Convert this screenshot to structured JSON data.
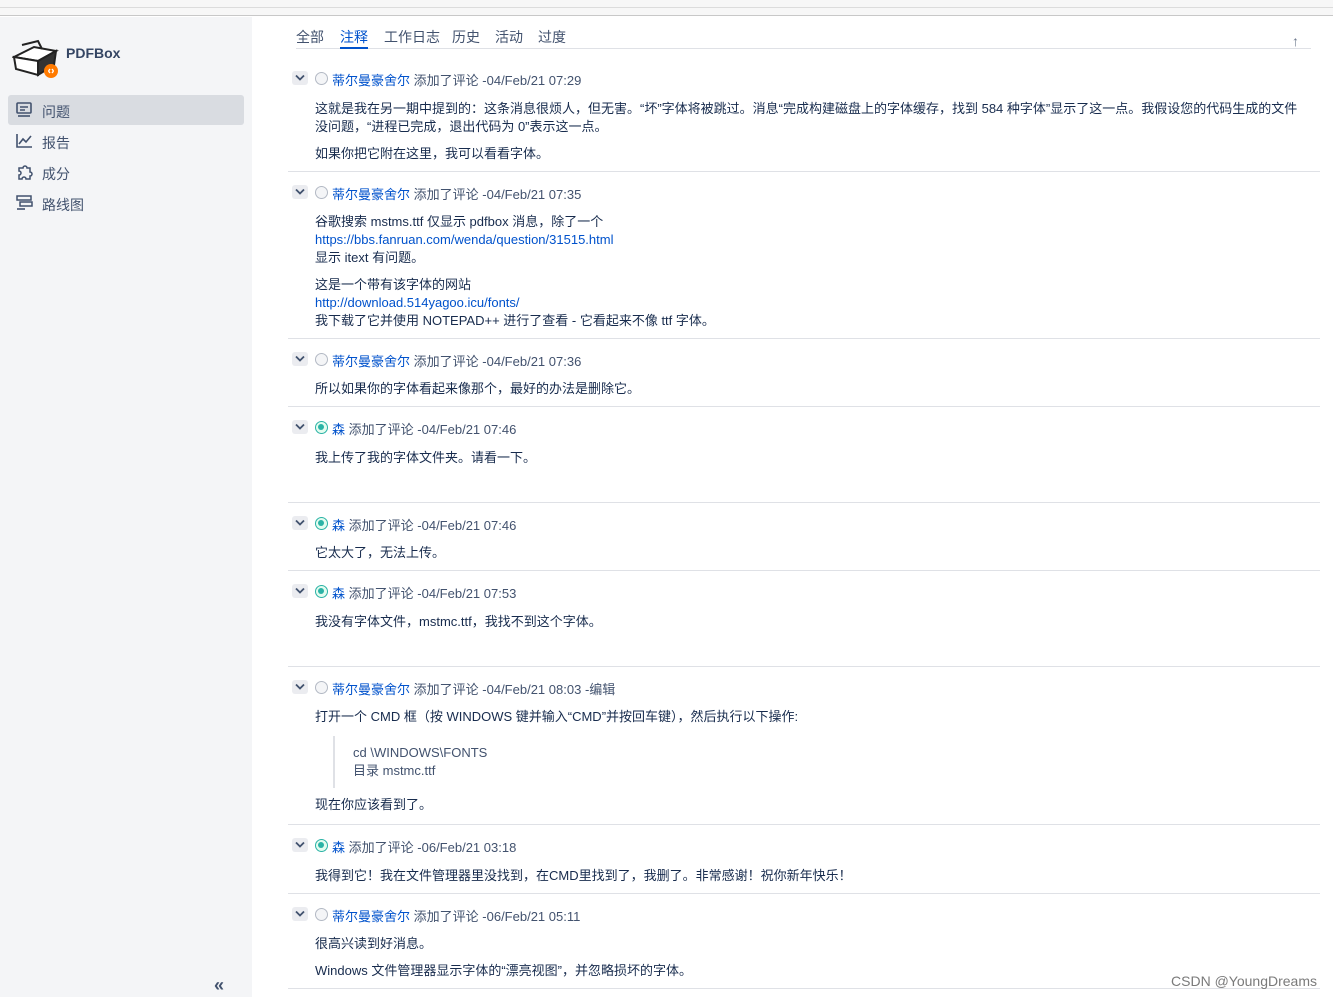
{
  "project": {
    "name": "PDFBox"
  },
  "sidebar": {
    "items": [
      {
        "label": "问题",
        "icon": "issues-icon",
        "active": true
      },
      {
        "label": "报告",
        "icon": "reports-icon"
      },
      {
        "label": "成分",
        "icon": "components-icon"
      },
      {
        "label": "路线图",
        "icon": "roadmap-icon"
      }
    ],
    "collapse_label": "«"
  },
  "tabs": [
    "全部",
    "注释",
    "工作日志",
    "历史",
    "活动",
    "过度"
  ],
  "active_tab": 1,
  "sort_label": "↑",
  "comments": [
    {
      "author": "蒂尔曼豪舍尔",
      "action": "添加了评论",
      "time": "-04/Feb/21 07:29",
      "edited": "",
      "lines": [
        "这就是我在另一期中提到的：这条消息很烦人，但无害。“坏”字体将被跳过。消息“完成构建磁盘上的字体缓存，找到 584 种字体”显示了这一点。我假设您的代码生成的文件没问题，“进程已完成，退出代码为 0”表示这一点。",
        "如果你把它附在这里，我可以看看字体。"
      ]
    },
    {
      "author": "蒂尔曼豪舍尔",
      "action": "添加了评论",
      "time": "-04/Feb/21 07:35",
      "edited": "",
      "lines": [
        "谷歌搜索 mstms.ttf 仅显示 pdfbox 消息，除了一个",
        "https://bbs.fanruan.com/wenda/question/31515.html",
        "显示 itext 有问题。",
        "这是一个带有该字体的网站",
        "http://download.514yagoo.icu/fonts/",
        "我下载了它并使用 NOTEPAD++ 进行了查看 - 它看起来不像 ttf 字体。"
      ]
    },
    {
      "author": "蒂尔曼豪舍尔",
      "action": "添加了评论",
      "time": "-04/Feb/21 07:36",
      "edited": "",
      "lines": [
        "所以如果你的字体看起来像那个，最好的办法是删除它。"
      ]
    },
    {
      "author": "森",
      "action": "添加了评论",
      "time": "-04/Feb/21 07:46",
      "edited": "",
      "lines": [
        "我上传了我的字体文件夹。请看一下。"
      ]
    },
    {
      "author": "森",
      "action": "添加了评论",
      "time": "-04/Feb/21 07:46",
      "edited": "",
      "lines": [
        "它太大了，无法上传。"
      ]
    },
    {
      "author": "森",
      "action": "添加了评论",
      "time": "-04/Feb/21 07:53",
      "edited": "",
      "lines": [
        "我没有字体文件，mstmc.ttf，我找不到这个字体。"
      ]
    },
    {
      "author": "蒂尔曼豪舍尔",
      "action": "添加了评论",
      "time": "-04/Feb/21 08:03",
      "edited": "-编辑",
      "lines": [
        "打开一个 CMD 框（按 WINDOWS 键并输入“CMD”并按回车键），然后执行以下操作:",
        "cd \\WINDOWS\\FONTS",
        "目录 mstmc.ttf",
        "现在你应该看到了。"
      ]
    },
    {
      "author": "森",
      "action": "添加了评论",
      "time": "-06/Feb/21 03:18",
      "edited": "",
      "lines": [
        "我得到它！我在文件管理器里没找到，在CMD里找到了，我删了。非常感谢！祝你新年快乐！"
      ]
    },
    {
      "author": "蒂尔曼豪舍尔",
      "action": "添加了评论",
      "time": "-06/Feb/21 05:11",
      "edited": "",
      "lines": [
        "很高兴读到好消息。",
        "Windows 文件管理器显示字体的“漂亮视图”，并忽略损坏的字体。"
      ]
    }
  ],
  "watermark": "CSDN @YoungDreams"
}
